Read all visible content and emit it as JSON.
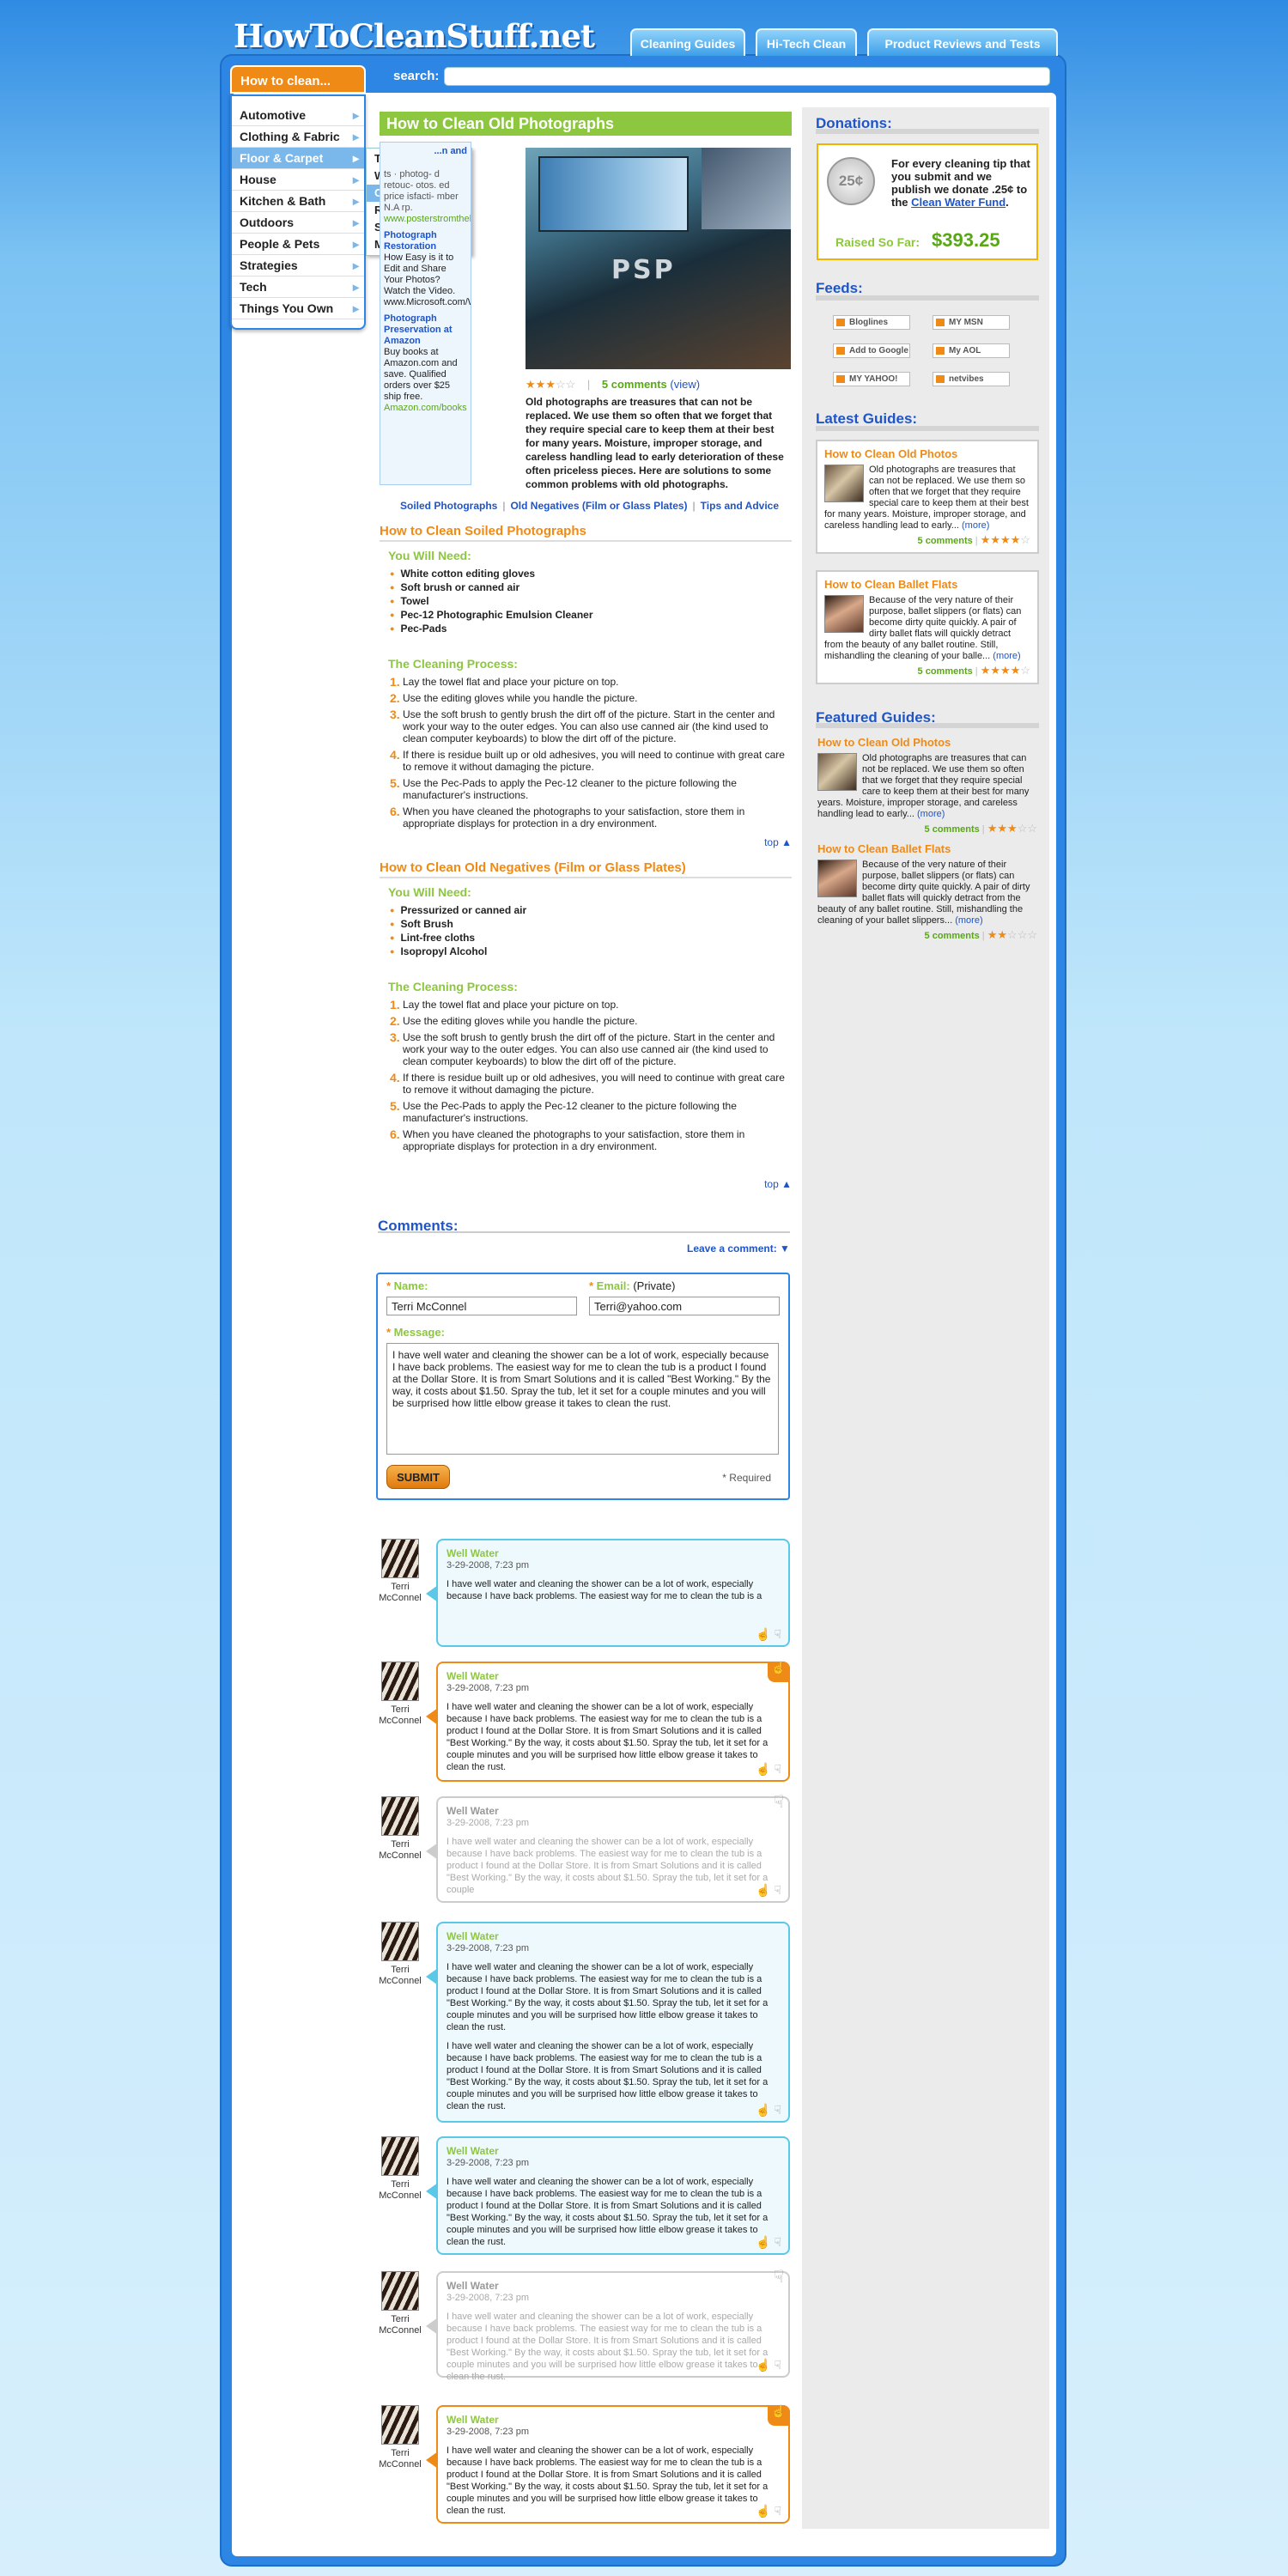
{
  "site": {
    "logo": "HowToCleanStuff.net",
    "tabs": [
      "Cleaning Guides",
      "Hi-Tech Clean",
      "Product Reviews and Tests"
    ]
  },
  "search": {
    "button_label": "How to clean...",
    "label": "search:",
    "value": ""
  },
  "categories": [
    "Automotive",
    "Clothing & Fabric",
    "Floor & Carpet",
    "House",
    "Kitchen & Bath",
    "Outdoors",
    "People & Pets",
    "Strategies",
    "Tech",
    "Things You Own"
  ],
  "active_category": "Floor & Carpet",
  "submenu": [
    "Tile",
    "Wood",
    "Carpet",
    "Rugs",
    "Something Else",
    "More options"
  ],
  "active_submenu": "Carpet",
  "ads": {
    "partial_title": "...n and",
    "partial_text": "ts · photog- d retouc- otos. ed price isfacti- mber N.A rp.",
    "partial_url": "www.posterstromtheheart.com",
    "items": [
      {
        "title": "Photograph Restoration",
        "text": "How Easy is it to Edit and Share Your Photos? Watch the Video.",
        "url": "www.Microsoft.com/Windows"
      },
      {
        "title": "Photograph Preservation at Amazon",
        "text": "Buy books at Amazon.com and save. Qualified orders over $25 ship free.",
        "url": "Amazon.com/books"
      }
    ]
  },
  "article": {
    "title": "How to Clean Old Photographs",
    "photo_label": "PSP",
    "rating": {
      "stars": 3,
      "max": 5,
      "comments": "5 comments",
      "view": "(view)"
    },
    "intro": "Old photographs are treasures that can not be replaced. We use them so often that we forget that they require special care to keep them at their best for many years. Moisture, improper storage, and careless handling lead to early deterioration of these often priceless pieces. Here are solutions to some common problems with old photographs.",
    "anchors": [
      "Soiled Photographs",
      "Old Negatives (Film or Glass Plates)",
      "Tips and Advice"
    ]
  },
  "sections": [
    {
      "title": "How to Clean Soiled Photographs",
      "need_label": "You Will Need:",
      "needs": [
        "White cotton editing gloves",
        "Soft brush or canned air",
        "Towel",
        "Pec-12 Photographic Emulsion Cleaner",
        "Pec-Pads"
      ],
      "process_label": "The Cleaning Process:",
      "steps": [
        "Lay the towel flat and place your picture on top.",
        "Use the editing gloves while you handle the picture.",
        "Use the soft brush to gently brush the dirt off of the picture. Start in the center and work your way to the outer edges. You can also use canned air (the kind used to clean computer keyboards) to blow the dirt off of the picture.",
        "If there is residue built up or old adhesives, you will need to continue with great care to remove it without damaging the picture.",
        "Use the Pec-Pads to apply the Pec-12 cleaner to the picture following the manufacturer's instructions.",
        "When you have cleaned the photographs to your satisfaction, store them in appropriate displays for protection in a dry environment."
      ],
      "top": "top ▲"
    },
    {
      "title": "How to Clean Old Negatives (Film or Glass Plates)",
      "need_label": "You Will Need:",
      "needs": [
        "Pressurized or canned air",
        "Soft Brush",
        "Lint-free cloths",
        "Isopropyl Alcohol"
      ],
      "process_label": "The Cleaning Process:",
      "steps": [
        "Lay the towel flat and place your picture on top.",
        "Use the editing gloves while you handle the picture.",
        "Use the soft brush to gently brush the dirt off of the picture. Start in the center and work your way to the outer edges. You can also use canned air (the kind used to clean computer keyboards) to blow the dirt off of the picture.",
        "If there is residue built up or old adhesives, you will need to continue with great care to remove it without damaging the picture.",
        "Use the Pec-Pads to apply the Pec-12 cleaner to the picture following the manufacturer's instructions.",
        "When you have cleaned the photographs to your satisfaction, store them in appropriate displays for protection in a dry environment."
      ],
      "top": "top ▲"
    }
  ],
  "comments_section": {
    "heading": "Comments:",
    "leave": "Leave a comment: ▼",
    "form": {
      "name_label": "Name:",
      "name_value": "Terri McConnel",
      "email_label": "Email:",
      "email_note": "(Private)",
      "email_value": "Terri@yahoo.com",
      "message_label": "Message:",
      "message_value": "I have well water and cleaning the shower can be a lot of work, especially because I have back problems. The easiest way for me to clean the tub is a product I found at the Dollar Store. It is from Smart Solutions and it is called \"Best Working.\" By the way, it costs about $1.50. Spray the tub, let it set for a couple minutes and you will be surprised how little elbow grease it takes to clean the rust.",
      "submit": "SUBMIT",
      "required": "* Required"
    }
  },
  "comments": [
    {
      "title": "Well Water",
      "date": "3-29-2008, 7:23 pm",
      "author": "Terri McConnel",
      "style": "blue",
      "paras": [
        "I have well water and cleaning the shower can be a lot of work, especially because I have back problems. The easiest way for me to clean the tub is a"
      ]
    },
    {
      "title": "Well Water",
      "date": "3-29-2008, 7:23 pm",
      "author": "Terri McConnel",
      "style": "orange",
      "paras": [
        "I have well water and cleaning the shower can be a lot of work, especially because I have back problems. The easiest way for me to clean the tub is a product I found at the Dollar Store. It is from Smart Solutions and it is called \"Best Working.\" By the way, it costs about $1.50. Spray the tub, let it set for a couple minutes and you will be surprised how little elbow grease it takes to clean the rust."
      ]
    },
    {
      "title": "Well Water",
      "date": "3-29-2008, 7:23 pm",
      "author": "Terri McConnel",
      "style": "grey",
      "paras": [
        "I have well water and cleaning the shower can be a lot of work, especially because I have back problems. The easiest way for me to clean the tub is a product I found at the Dollar Store. It is from Smart Solutions and it is called \"Best Working.\" By the way, it costs about $1.50. Spray the tub, let it set for a couple"
      ]
    },
    {
      "title": "Well Water",
      "date": "3-29-2008, 7:23 pm",
      "author": "Terri McConnel",
      "style": "blue",
      "paras": [
        "I have well water and cleaning the shower can be a lot of work, especially because I have back problems. The easiest way for me to clean the tub is a product I found at the Dollar Store. It is from Smart Solutions and it is called \"Best Working.\" By the way, it costs about $1.50. Spray the tub, let it set for a couple minutes and you will be surprised how little elbow grease it takes to clean the rust.",
        "I have well water and cleaning the shower can be a lot of work, especially because I have back problems. The easiest way for me to clean the tub is a product I found at the Dollar Store. It is from Smart Solutions and it is called \"Best Working.\" By the way, it costs about $1.50. Spray the tub, let it set for a couple minutes and you will be surprised how little elbow grease it takes to clean the rust."
      ]
    },
    {
      "title": "Well Water",
      "date": "3-29-2008, 7:23 pm",
      "author": "Terri McConnel",
      "style": "blue",
      "paras": [
        "I have well water and cleaning the shower can be a lot of work, especially because I have back problems. The easiest way for me to clean the tub is a product I found at the Dollar Store. It is from Smart Solutions and it is called \"Best Working.\" By the way, it costs about $1.50. Spray the tub, let it set for a couple minutes and you will be surprised how little elbow grease it takes to clean the rust."
      ]
    },
    {
      "title": "Well Water",
      "date": "3-29-2008, 7:23 pm",
      "author": "Terri McConnel",
      "style": "grey",
      "paras": [
        "I have well water and cleaning the shower can be a lot of work, especially because I have back problems. The easiest way for me to clean the tub is a product I found at the Dollar Store. It is from Smart Solutions and it is called \"Best Working.\" By the way, it costs about $1.50. Spray the tub, let it set for a couple minutes and you will be surprised how little elbow grease it takes to clean the rust."
      ]
    },
    {
      "title": "Well Water",
      "date": "3-29-2008, 7:23 pm",
      "author": "Terri McConnel",
      "style": "orange",
      "paras": [
        "I have well water and cleaning the shower can be a lot of work, especially because I have back problems. The easiest way for me to clean the tub is a product I found at the Dollar Store. It is from Smart Solutions and it is called \"Best Working.\" By the way, it costs about $1.50. Spray the tub, let it set for a couple minutes and you will be surprised how little elbow grease it takes to clean the rust."
      ]
    }
  ],
  "sidebar": {
    "donations": {
      "heading": "Donations:",
      "coin": "25¢",
      "text_a": "For every cleaning tip that you submit and we publish we donate .25¢ to the ",
      "link": "Clean Water Fund",
      "text_b": ".",
      "raised_label": "Raised So Far:",
      "raised_value": "$393.25"
    },
    "feeds": {
      "heading": "Feeds:",
      "items": [
        "Bloglines",
        "MY MSN",
        "Add to Google",
        "My AOL",
        "MY YAHOO!",
        "netvibes"
      ]
    },
    "latest": {
      "heading": "Latest Guides:",
      "items": [
        {
          "title": "How to Clean Old Photos",
          "img": "photos",
          "text": "Old photographs are treasures that can not be replaced. We use them so often that we forget that they require special care to keep them at their best for many years. Moisture, improper storage, and careless handling lead to early...",
          "more": "(more)",
          "comments": "5 comments",
          "stars": 4
        },
        {
          "title": "How to Clean Ballet Flats",
          "img": "ballet",
          "text": "Because of the very nature of their purpose, ballet slippers (or flats) can become dirty quite quickly. A pair of dirty ballet flats will quickly detract from the beauty of any ballet routine. Still, mishandling the cleaning of your balle...",
          "more": "(more)",
          "comments": "5 comments",
          "stars": 4
        }
      ]
    },
    "featured": {
      "heading": "Featured Guides:",
      "items": [
        {
          "title": "How to Clean Old Photos",
          "img": "photos",
          "text": "Old photographs are treasures that can not be replaced. We use them so often that we forget that they require special care to keep them at their best for many years. Moisture, improper storage, and careless handling lead to early...",
          "more": "(more)",
          "comments": "5 comments",
          "stars": 3
        },
        {
          "title": "How to Clean Ballet Flats",
          "img": "ballet",
          "text": "Because of the very nature of their purpose, ballet slippers (or flats) can become dirty quite quickly. A pair of dirty ballet flats will quickly detract from the beauty of any ballet routine. Still, mishandling the cleaning of your ballet slippers...",
          "more": "(more)",
          "comments": "5 comments",
          "stars": 2
        }
      ]
    }
  }
}
